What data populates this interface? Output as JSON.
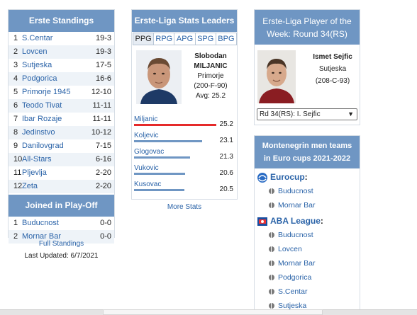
{
  "standings": {
    "title": "Erste Standings",
    "rows": [
      {
        "rank": "1",
        "team": "S.Centar",
        "record": "19-3"
      },
      {
        "rank": "2",
        "team": "Lovcen",
        "record": "19-3"
      },
      {
        "rank": "3",
        "team": "Sutjeska",
        "record": "17-5"
      },
      {
        "rank": "4",
        "team": "Podgorica",
        "record": "16-6"
      },
      {
        "rank": "5",
        "team": "Primorje 1945",
        "record": "12-10"
      },
      {
        "rank": "6",
        "team": "Teodo Tivat",
        "record": "11-11"
      },
      {
        "rank": "7",
        "team": "Ibar Rozaje",
        "record": "11-11"
      },
      {
        "rank": "8",
        "team": "Jedinstvo",
        "record": "10-12"
      },
      {
        "rank": "9",
        "team": "Danilovgrad",
        "record": "7-15"
      },
      {
        "rank": "10",
        "team": "All-Stars",
        "record": "6-16"
      },
      {
        "rank": "11",
        "team": "Pljevlja",
        "record": "2-20"
      },
      {
        "rank": "12",
        "team": "Zeta",
        "record": "2-20"
      }
    ],
    "playoff_title": "Joined in Play-Off",
    "playoff_rows": [
      {
        "rank": "1",
        "team": "Buducnost",
        "record": "0-0"
      },
      {
        "rank": "2",
        "team": "Mornar Bar",
        "record": "0-0"
      }
    ],
    "full_standings": "Full Standings",
    "last_updated": "Last Updated: 6/7/2021"
  },
  "leaders": {
    "title": "Erste-Liga Stats Leaders",
    "tabs": [
      "PPG",
      "RPG",
      "APG",
      "SPG",
      "BPG"
    ],
    "active_tab": "PPG",
    "player": {
      "first": "Slobodan",
      "last": "MILJANIC",
      "team": "Primorje",
      "bio": "(200-F-90)",
      "avg": "Avg: 25.2"
    },
    "bars": [
      {
        "name": "Miljanic",
        "value": 25.2,
        "value_text": "25.2"
      },
      {
        "name": "Koljevic",
        "value": 23.1,
        "value_text": "23.1"
      },
      {
        "name": "Glogovac",
        "value": 21.3,
        "value_text": "21.3"
      },
      {
        "name": "Vukovic",
        "value": 20.6,
        "value_text": "20.6"
      },
      {
        "name": "Kusovac",
        "value": 20.5,
        "value_text": "20.5"
      }
    ],
    "more_stats": "More Stats"
  },
  "potw": {
    "title_line1": "Erste-Liga Player of the",
    "title_line2": "Week: Round 34(RS)",
    "name": "Ismet Sejfic",
    "team": "Sutjeska",
    "bio": "(208-C-93)",
    "select_value": "Rd 34(RS): I. Sejfic"
  },
  "euro": {
    "title_line1": "Montenegrin men teams",
    "title_line2": "in Euro cups 2021-2022",
    "eurocup": {
      "label": "Eurocup",
      "colon": ":",
      "clubs": [
        "Buducnost",
        "Mornar Bar"
      ]
    },
    "aba": {
      "label": "ABA League",
      "colon": ":",
      "clubs": [
        "Buducnost",
        "Lovcen",
        "Mornar Bar",
        "Podgorica",
        "S.Centar",
        "Sutjeska"
      ]
    }
  },
  "colors": {
    "header_blue": "#6f96c3",
    "link_blue": "#2a63a8",
    "leader_bar": "#e52a2a",
    "bar": "#6f96c3"
  }
}
